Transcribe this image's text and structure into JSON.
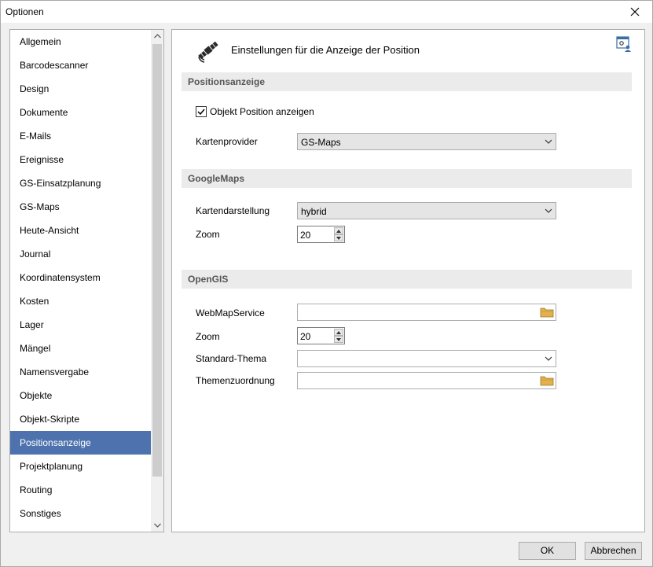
{
  "window": {
    "title": "Optionen"
  },
  "nav": {
    "items": [
      "Allgemein",
      "Barcodescanner",
      "Design",
      "Dokumente",
      "E-Mails",
      "Ereignisse",
      "GS-Einsatzplanung",
      "GS-Maps",
      "Heute-Ansicht",
      "Journal",
      "Koordinatensystem",
      "Kosten",
      "Lager",
      "Mängel",
      "Namensvergabe",
      "Objekte",
      "Objekt-Skripte",
      "Positionsanzeige",
      "Projektplanung",
      "Routing",
      "Sonstiges"
    ],
    "selected": "Positionsanzeige"
  },
  "panel": {
    "title": "Einstellungen für die Anzeige der Position",
    "sections": {
      "position": {
        "header": "Positionsanzeige",
        "show_position_label": "Objekt Position anzeigen",
        "show_position_checked": true,
        "map_provider_label": "Kartenprovider",
        "map_provider_value": "GS-Maps"
      },
      "googlemaps": {
        "header": "GoogleMaps",
        "map_display_label": "Kartendarstellung",
        "map_display_value": "hybrid",
        "zoom_label": "Zoom",
        "zoom_value": "20"
      },
      "opengis": {
        "header": "OpenGIS",
        "wms_label": "WebMapService",
        "wms_value": "",
        "zoom_label": "Zoom",
        "zoom_value": "20",
        "theme_label": "Standard-Thema",
        "theme_value": "",
        "theme_assignment_label": "Themenzuordnung",
        "theme_assignment_value": ""
      }
    }
  },
  "buttons": {
    "ok": "OK",
    "cancel": "Abbrechen"
  },
  "colors": {
    "selection": "#4d72ad",
    "section_bg": "#ebebeb",
    "section_text": "#555555"
  }
}
